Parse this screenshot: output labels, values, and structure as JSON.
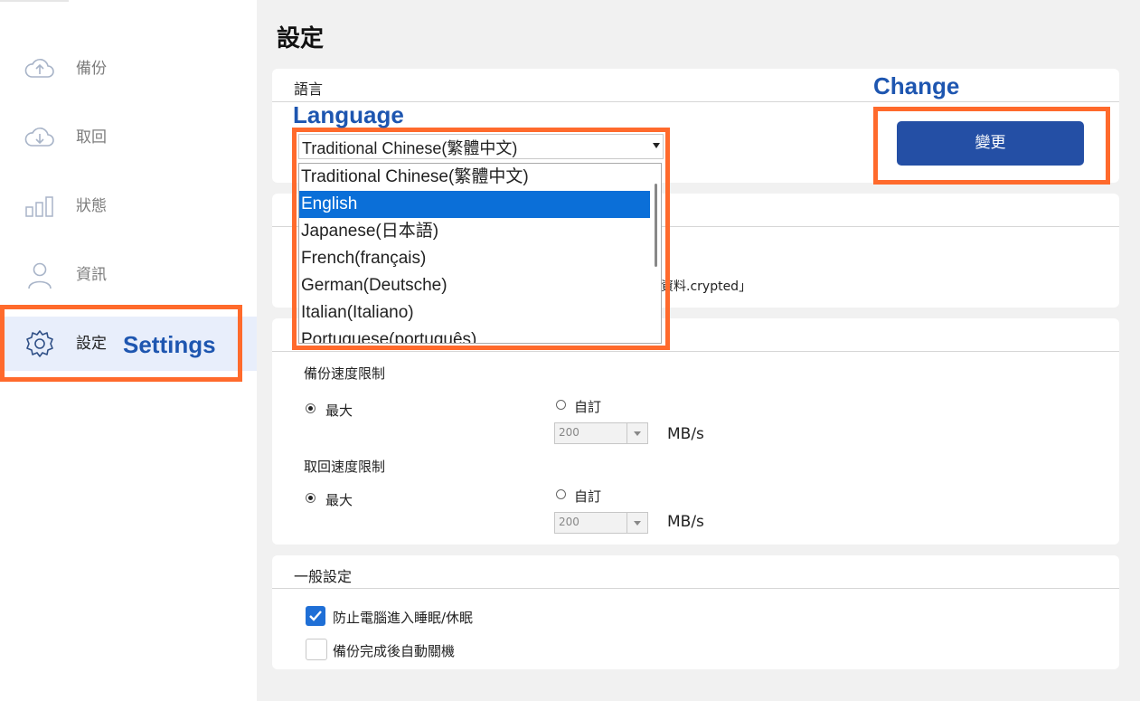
{
  "sidebar": {
    "items": [
      {
        "label": "備份",
        "icon": "cloud-upload-icon"
      },
      {
        "label": "取回",
        "icon": "cloud-download-icon"
      },
      {
        "label": "狀態",
        "icon": "bar-chart-icon"
      },
      {
        "label": "資訊",
        "icon": "user-icon"
      },
      {
        "label": "設定",
        "icon": "gear-icon",
        "active": true
      }
    ]
  },
  "annotations": {
    "settings": "Settings",
    "language": "Language",
    "change": "Change",
    "highlight_color": "#ff6a2c",
    "label_color": "#1e56b0"
  },
  "main": {
    "title": "設定",
    "language_card": {
      "header": "語言",
      "selected": "Traditional Chinese(繁體中文)",
      "options": [
        "Traditional Chinese(繁體中文)",
        "English",
        "Japanese(日本語)",
        "French(français)",
        "German(Deutsche)",
        "Italian(Italiano)",
        "Portuguese(português)"
      ],
      "highlighted_option": "English",
      "change_button": "變更"
    },
    "encryption_card": {
      "visible_text": "資料.crypted」"
    },
    "speed_card": {
      "backup_limit_label": "備份速度限制",
      "restore_limit_label": "取回速度限制",
      "max_label": "最大",
      "custom_label": "自訂",
      "backup_value": "200",
      "restore_value": "200",
      "unit": "MB/s",
      "backup_selected": "最大",
      "restore_selected": "最大"
    },
    "general_card": {
      "header": "一般設定",
      "options": [
        {
          "label": "防止電腦進入睡眠/休眠",
          "checked": true
        },
        {
          "label": "備份完成後自動關機",
          "checked": false
        }
      ]
    }
  },
  "colors": {
    "accent": "#244fa5",
    "selection": "#0b6fd8",
    "checkbox": "#1f6fd6"
  }
}
